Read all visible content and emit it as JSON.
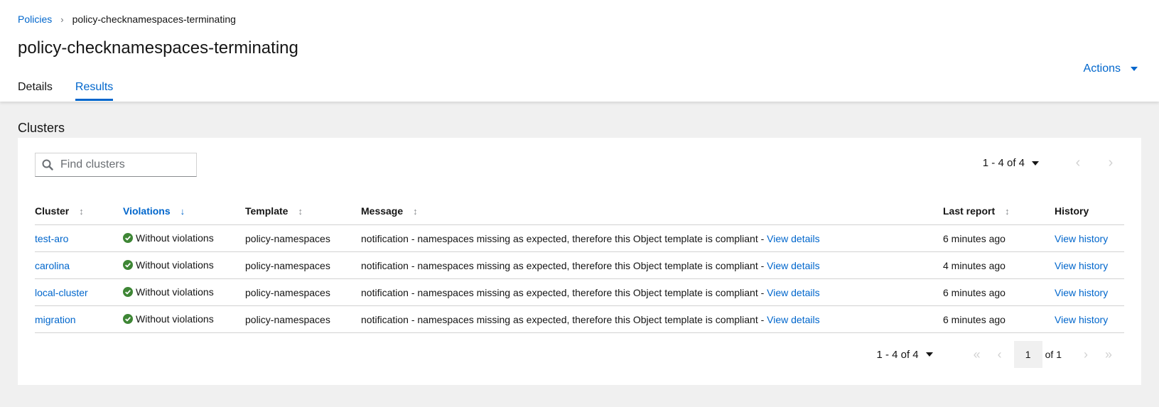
{
  "breadcrumb": {
    "parent": "Policies",
    "separator": "›",
    "current": "policy-checknamespaces-terminating"
  },
  "page": {
    "title": "policy-checknamespaces-terminating"
  },
  "tabs": [
    {
      "label": "Details"
    },
    {
      "label": "Results"
    }
  ],
  "actions": {
    "label": "Actions"
  },
  "clusters": {
    "title": "Clusters",
    "search": {
      "placeholder": "Find clusters",
      "value": ""
    },
    "pagination": {
      "range": "1 - 4 of 4",
      "page": "1",
      "of_pages": "of 1"
    },
    "columns": [
      "Cluster",
      "Violations",
      "Template",
      "Message",
      "Last report",
      "History"
    ],
    "rows": [
      {
        "cluster": "test-aro",
        "violation": "Without violations",
        "template": "policy-namespaces",
        "message": "notification - namespaces missing as expected, therefore this Object template is compliant - ",
        "message_link": "View details",
        "last_report": "6 minutes ago",
        "history": "View history"
      },
      {
        "cluster": "carolina",
        "violation": "Without violations",
        "template": "policy-namespaces",
        "message": "notification - namespaces missing as expected, therefore this Object template is compliant - ",
        "message_link": "View details",
        "last_report": "4 minutes ago",
        "history": "View history"
      },
      {
        "cluster": "local-cluster",
        "violation": "Without violations",
        "template": "policy-namespaces",
        "message": "notification - namespaces missing as expected, therefore this Object template is compliant - ",
        "message_link": "View details",
        "last_report": "6 minutes ago",
        "history": "View history"
      },
      {
        "cluster": "migration",
        "violation": "Without violations",
        "template": "policy-namespaces",
        "message": "notification - namespaces missing as expected, therefore this Object template is compliant - ",
        "message_link": "View details",
        "last_report": "6 minutes ago",
        "history": "View history"
      }
    ]
  },
  "icons": {
    "search": "search-icon",
    "status_ok": "check-circle-icon",
    "sort": "sort-icon",
    "sort_desc": "sort-down-icon"
  },
  "colors": {
    "link": "#0066cc",
    "success": "#3e8635",
    "border": "#d2d2d2",
    "background": "#f0f0f0"
  }
}
